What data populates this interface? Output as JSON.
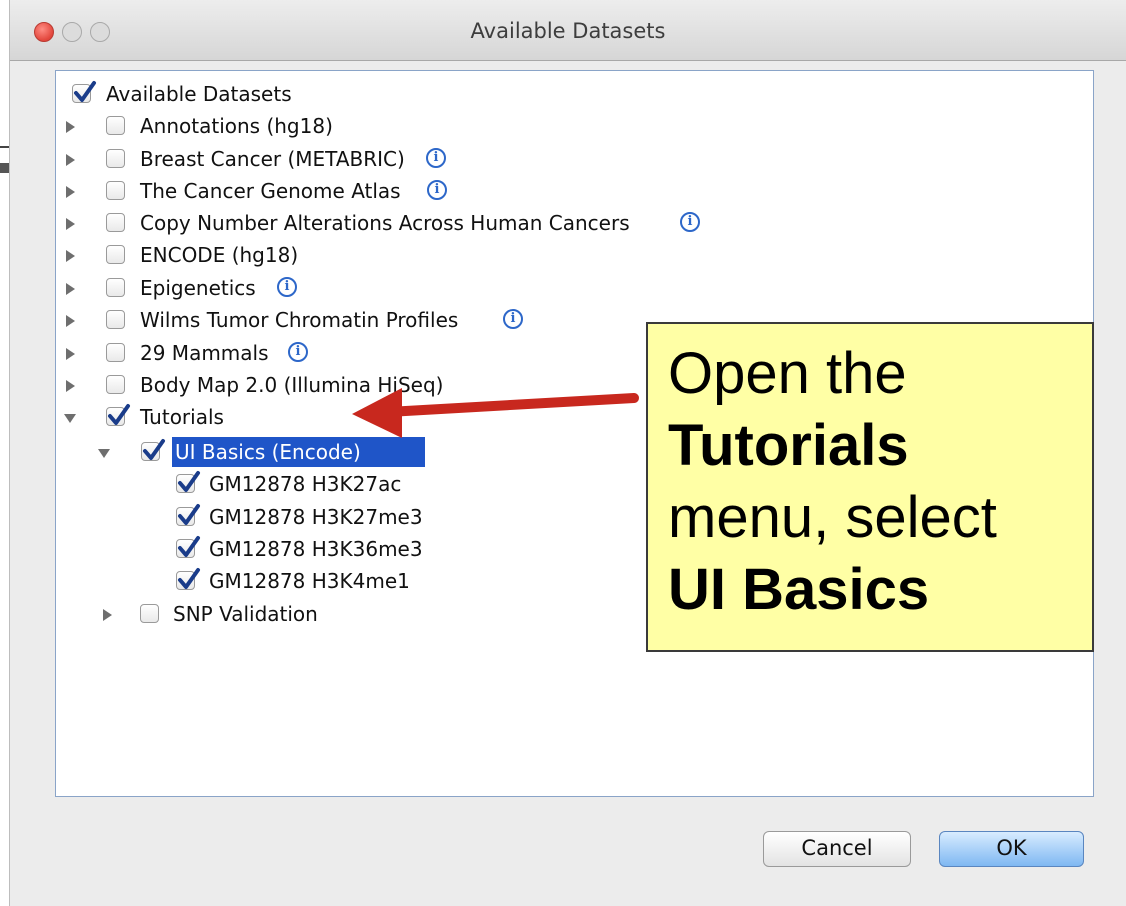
{
  "window": {
    "title": "Available Datasets"
  },
  "tree": {
    "root": {
      "label": "Available Datasets",
      "checked": true
    },
    "items": [
      {
        "label": "Annotations (hg18)",
        "checked": false,
        "expanded": false,
        "info": false
      },
      {
        "label": "Breast Cancer (METABRIC)",
        "checked": false,
        "expanded": false,
        "info": true
      },
      {
        "label": "The Cancer Genome Atlas",
        "checked": false,
        "expanded": false,
        "info": true
      },
      {
        "label": "Copy Number Alterations Across Human Cancers",
        "checked": false,
        "expanded": false,
        "info": true
      },
      {
        "label": "ENCODE (hg18)",
        "checked": false,
        "expanded": false,
        "info": false
      },
      {
        "label": "Epigenetics",
        "checked": false,
        "expanded": false,
        "info": true
      },
      {
        "label": "Wilms Tumor Chromatin Profiles",
        "checked": false,
        "expanded": false,
        "info": true
      },
      {
        "label": "29 Mammals",
        "checked": false,
        "expanded": false,
        "info": true
      },
      {
        "label": "Body Map 2.0 (Illumina HiSeq)",
        "checked": false,
        "expanded": false,
        "info": false
      },
      {
        "label": "Tutorials",
        "checked": true,
        "expanded": true,
        "info": false
      }
    ],
    "tutorials": {
      "ui_basics": {
        "label": "UI Basics (Encode)",
        "checked": true,
        "expanded": true,
        "selected": true
      },
      "ui_basics_children": [
        {
          "label": "GM12878 H3K27ac",
          "checked": true
        },
        {
          "label": "GM12878 H3K27me3",
          "checked": true
        },
        {
          "label": "GM12878 H3K36me3",
          "checked": true
        },
        {
          "label": "GM12878 H3K4me1",
          "checked": true
        }
      ],
      "snp_validation": {
        "label": "SNP Validation",
        "checked": false,
        "expanded": false
      }
    }
  },
  "callout": {
    "line1": "Open the",
    "line2": "Tutorials",
    "line3": "menu, select",
    "line4": "UI Basics"
  },
  "buttons": {
    "cancel": "Cancel",
    "ok": "OK"
  },
  "colors": {
    "selection": "#1f55c8",
    "callout_bg": "#ffffa5",
    "arrow": "#c8281e",
    "info_icon": "#2d67c9",
    "check": "#1a3c8a"
  }
}
